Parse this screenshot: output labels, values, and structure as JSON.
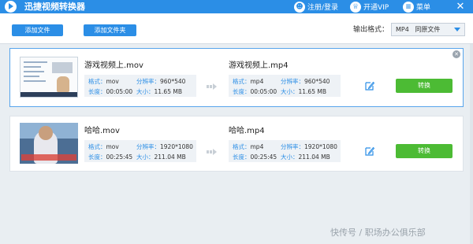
{
  "app": {
    "title": "迅捷视频转换器"
  },
  "titlebar": {
    "login_label": "注册/登录",
    "vip_label": "开通VIP",
    "menu_label": "菜单"
  },
  "toolbar": {
    "add_file_label": "添加文件",
    "add_folder_label": "添加文件夹",
    "output_format_label": "输出格式：",
    "output_format_value": "MP4",
    "output_format_detail": "同原文件"
  },
  "labels": {
    "format": "格式：",
    "resolution": "分辨率：",
    "duration": "长度：",
    "size": "大小：",
    "convert": "转换"
  },
  "files": [
    {
      "source": {
        "name": "游戏视频上.mov",
        "format": "mov",
        "resolution": "960*540",
        "duration": "00:05:00",
        "size": "11.65 MB"
      },
      "target": {
        "name": "游戏视频上.mp4",
        "format": "mp4",
        "resolution": "960*540",
        "duration": "00:05:00",
        "size": "11.65 MB"
      }
    },
    {
      "source": {
        "name": "哈哈.mov",
        "format": "mov",
        "resolution": "1920*1080",
        "duration": "00:25:45",
        "size": "211.04 MB"
      },
      "target": {
        "name": "哈哈.mp4",
        "format": "mp4",
        "resolution": "1920*1080",
        "duration": "00:25:45",
        "size": "211.04 MB"
      }
    }
  ],
  "watermark": "快传号 / 职场办公俱乐部"
}
